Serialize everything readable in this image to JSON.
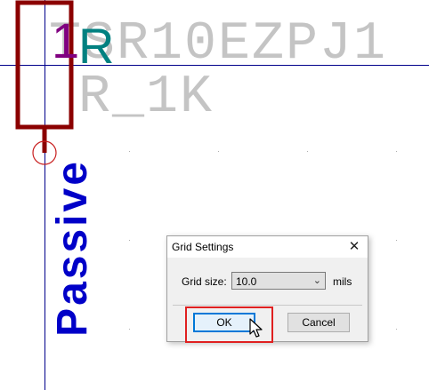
{
  "schematic": {
    "part_value_ghost": "TSR10EZPJ1",
    "footprint_ghost": "R_1K",
    "pin_number": "1",
    "reference": "R",
    "pin_type": "Passive",
    "colors": {
      "body": "#8b0000",
      "pin_line": "#8b0000",
      "reference_text": "#008080",
      "pin_number_text": "#800080",
      "pin_type_text": "#0000c8",
      "cursor_line": "#00008b",
      "ghost_text": "#c4c4c4"
    }
  },
  "dialog": {
    "title": "Grid Settings",
    "close_icon": "close-icon",
    "grid_size_label": "Grid size:",
    "grid_size_value": "10.0",
    "grid_size_unit": "mils",
    "ok_label": "OK",
    "cancel_label": "Cancel"
  },
  "annotation": {
    "highlight_color": "#e02020",
    "highlighted_target": "ok-button"
  },
  "cursor_icon": "mouse-pointer-icon"
}
